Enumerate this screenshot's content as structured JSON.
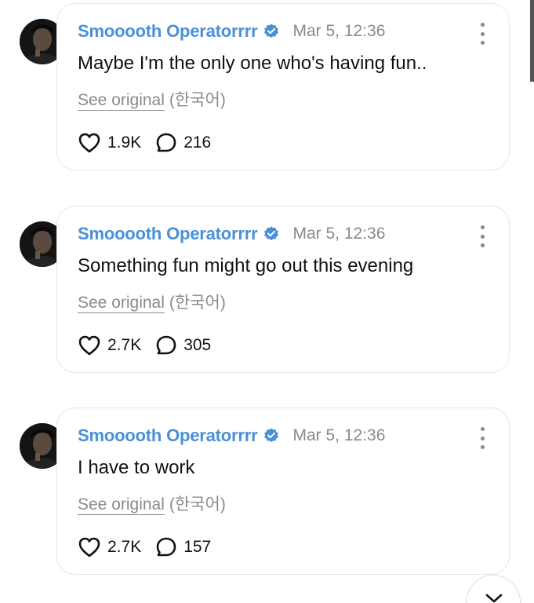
{
  "posts": [
    {
      "author": "Smooooth Operatorrrr",
      "timestamp": "Mar 5, 12:36",
      "text": "Maybe I'm the only one who's having fun..",
      "see_original": "See original",
      "language": "(한국어)",
      "likes": "1.9K",
      "replies": "216"
    },
    {
      "author": "Smooooth Operatorrrr",
      "timestamp": "Mar 5, 12:36",
      "text": "Something fun might go out this evening",
      "see_original": "See original",
      "language": "(한국어)",
      "likes": "2.7K",
      "replies": "305"
    },
    {
      "author": "Smooooth Operatorrrr",
      "timestamp": "Mar 5, 12:36",
      "text": "I have to work",
      "see_original": "See original",
      "language": "(한국어)",
      "likes": "2.7K",
      "replies": "157"
    }
  ],
  "icons": {
    "verified": "verified-badge-icon",
    "more": "more-vertical-icon",
    "like": "heart-icon",
    "reply": "speech-bubble-icon",
    "scroll": "chevron-down-icon"
  },
  "colors": {
    "author": "#4a90d9",
    "verified": "#4a90d9",
    "muted": "#8a8a8a",
    "text": "#111111",
    "border": "#e6e6e6"
  }
}
